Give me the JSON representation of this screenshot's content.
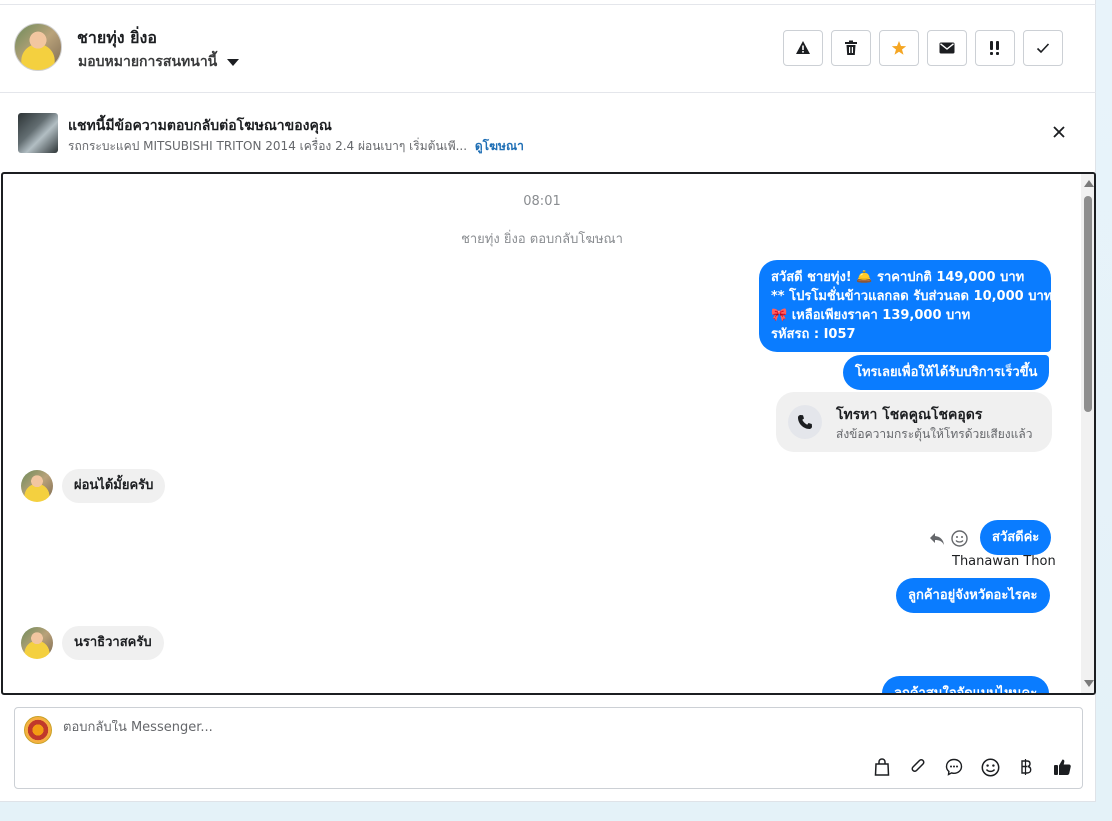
{
  "header": {
    "name": "ชายทุ่ง ยิ่งอ",
    "assign_label": "มอบหมายการสนทนานี้"
  },
  "ad": {
    "title": "แชทนี้มีข้อความตอบกลับต่อโฆษณาของคุณ",
    "description": "รถกระบะแคป MITSUBISHI TRITON 2014 เครื่อง 2.4 ผ่อนเบาๆ เริ่มต้นเพี...",
    "link": "ดูโฆษณา"
  },
  "chat": {
    "time": "08:01",
    "system_note": "ชายทุ่ง ยิ่งอ ตอบกลับโฆษณา",
    "offer_lines": [
      "สวัสดี ชายทุ่ง! 🛎️ ราคาปกติ 149,000 บาท",
      "** โปรโมชั่นข้าวแลกลด รับส่วนลด 10,000 บาท",
      "🎀  เหลือเพียงราคา 139,000 บาท",
      " รหัสรถ : I057"
    ],
    "call_prompt": "โทรเลยเพื่อให้ได้รับบริการเร็วขึ้น",
    "call_card": {
      "title": "โทรหา โชคคูณโชคอุดร",
      "subtitle": "ส่งข้อความกระตุ้นให้โทรด้วยเสียงแล้ว"
    },
    "incoming_1": "ผ่อนได้มั้ยครับ",
    "reply_hello": "สวัสดีค่ะ",
    "sender": "Thanawan Thon",
    "reply_province": "ลูกค้าอยู่จังหวัดอะไรคะ",
    "incoming_2": "นราธิวาสครับ",
    "reply_cut": "ลูกค้าสนใจจัดแบบไหนคะ"
  },
  "composer": {
    "placeholder": "ตอบกลับใน Messenger..."
  },
  "colors": {
    "outgoing": "#0a7cff",
    "incoming": "#f0f0f0",
    "star": "#f5a623"
  }
}
